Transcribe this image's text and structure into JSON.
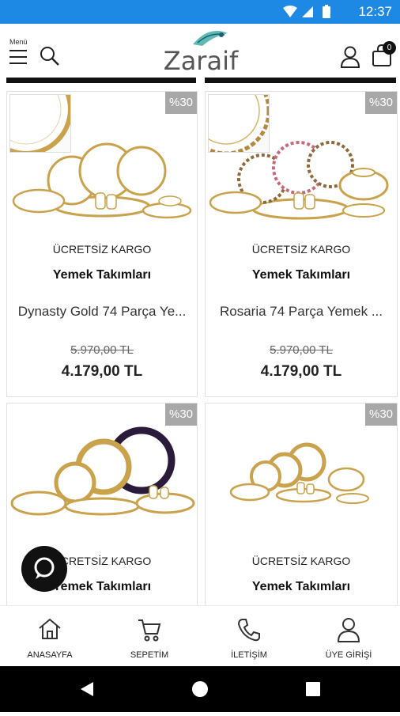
{
  "status_bar": {
    "time": "12:37"
  },
  "header": {
    "menu_label": "Menü",
    "logo_text": "Zaraif",
    "cart_count": "0"
  },
  "products": [
    {
      "discount": "%30",
      "shipping": "ÜCRETSİZ KARGO",
      "category": "Yemek Takımları",
      "name": "Dynasty Gold 74 Parça Ye...",
      "old_price": "5.970,00 TL",
      "price": "4.179,00 TL"
    },
    {
      "discount": "%30",
      "shipping": "ÜCRETSİZ KARGO",
      "category": "Yemek Takımları",
      "name": "Rosaria 74 Parça Yemek ...",
      "old_price": "5.970,00 TL",
      "price": "4.179,00 TL"
    },
    {
      "discount": "%30",
      "shipping": "ÜCRETSİZ KARGO",
      "category": "Yemek Takımları"
    },
    {
      "discount": "%30",
      "shipping": "ÜCRETSİZ KARGO",
      "category": "Yemek Takımları"
    }
  ],
  "bottom_nav": [
    {
      "label": "ANASAYFA",
      "icon": "home-icon"
    },
    {
      "label": "SEPETİM",
      "icon": "cart-icon"
    },
    {
      "label": "İLETİŞİM",
      "icon": "phone-icon"
    },
    {
      "label": "ÜYE GİRİŞİ",
      "icon": "user-icon"
    }
  ],
  "colors": {
    "status_bar": "#1e88e5",
    "discount_badge": "#a8a8a8",
    "gold": "#c9a24b"
  }
}
